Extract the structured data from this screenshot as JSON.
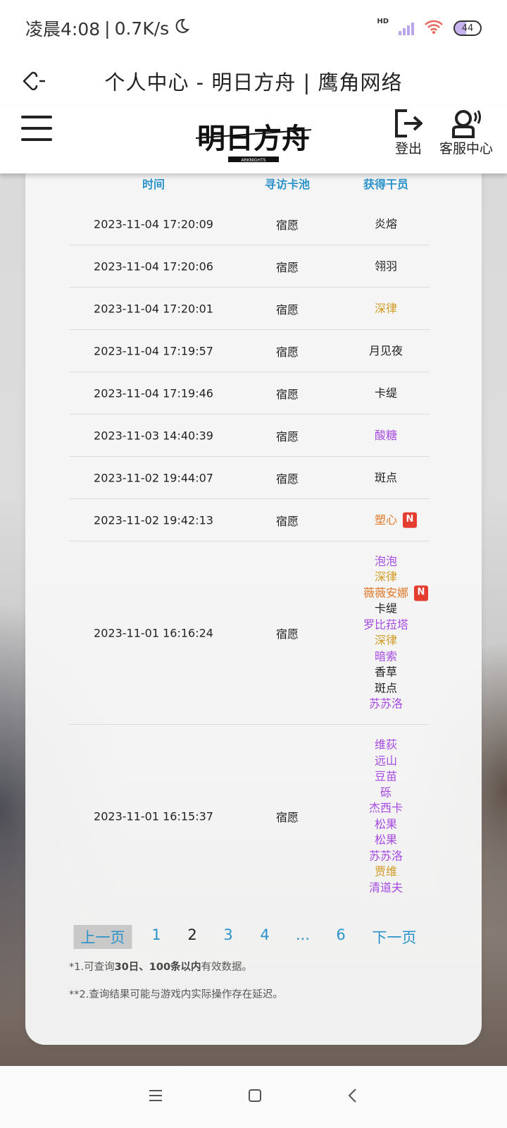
{
  "status": {
    "time": "凌晨4:08",
    "speed": "0.7K/s",
    "network": "HD",
    "battery": "44"
  },
  "browser": {
    "title": "个人中心 - 明日方舟 | 鹰角网络"
  },
  "header": {
    "logo_text": "明日方舟",
    "logo_subtext": "ARKNIGHTS",
    "logout_label": "登出",
    "service_label": "客服中心"
  },
  "table": {
    "headers": [
      "时间",
      "寻访卡池",
      "获得干员"
    ],
    "rows": [
      {
        "time": "2023-11-04 17:20:09",
        "pool": "宿愿",
        "ops": [
          {
            "name": "炎熔",
            "color": "#222222"
          }
        ]
      },
      {
        "time": "2023-11-04 17:20:06",
        "pool": "宿愿",
        "ops": [
          {
            "name": "翎羽",
            "color": "#222222"
          }
        ]
      },
      {
        "time": "2023-11-04 17:20:01",
        "pool": "宿愿",
        "ops": [
          {
            "name": "深律",
            "color": "#d19a22"
          }
        ]
      },
      {
        "time": "2023-11-04 17:19:57",
        "pool": "宿愿",
        "ops": [
          {
            "name": "月见夜",
            "color": "#222222"
          }
        ]
      },
      {
        "time": "2023-11-04 17:19:46",
        "pool": "宿愿",
        "ops": [
          {
            "name": "卡缇",
            "color": "#222222"
          }
        ]
      },
      {
        "time": "2023-11-03 14:40:39",
        "pool": "宿愿",
        "ops": [
          {
            "name": "酸糖",
            "color": "#a64be0"
          }
        ]
      },
      {
        "time": "2023-11-02 19:44:07",
        "pool": "宿愿",
        "ops": [
          {
            "name": "斑点",
            "color": "#222222"
          }
        ]
      },
      {
        "time": "2023-11-02 19:42:13",
        "pool": "宿愿",
        "ops": [
          {
            "name": "塑心",
            "color": "#e07828",
            "new": "N"
          }
        ]
      },
      {
        "time": "2023-11-01 16:16:24",
        "pool": "宿愿",
        "ops": [
          {
            "name": "泡泡",
            "color": "#a64be0"
          },
          {
            "name": "深律",
            "color": "#d19a22"
          },
          {
            "name": "薇薇安娜",
            "color": "#e07828",
            "new": "N"
          },
          {
            "name": "卡缇",
            "color": "#222222"
          },
          {
            "name": "罗比菈塔",
            "color": "#a64be0"
          },
          {
            "name": "深律",
            "color": "#d19a22"
          },
          {
            "name": "暗索",
            "color": "#a64be0"
          },
          {
            "name": "香草",
            "color": "#222222"
          },
          {
            "name": "斑点",
            "color": "#222222"
          },
          {
            "name": "苏苏洛",
            "color": "#a64be0"
          }
        ]
      },
      {
        "time": "2023-11-01 16:15:37",
        "pool": "宿愿",
        "ops": [
          {
            "name": "维荻",
            "color": "#a64be0"
          },
          {
            "name": "远山",
            "color": "#a64be0"
          },
          {
            "name": "豆苗",
            "color": "#a64be0"
          },
          {
            "name": "砾",
            "color": "#a64be0"
          },
          {
            "name": "杰西卡",
            "color": "#a64be0"
          },
          {
            "name": "松果",
            "color": "#a64be0"
          },
          {
            "name": "松果",
            "color": "#a64be0"
          },
          {
            "name": "苏苏洛",
            "color": "#a64be0"
          },
          {
            "name": "贾维",
            "color": "#d19a22"
          },
          {
            "name": "清道夫",
            "color": "#a64be0"
          }
        ]
      }
    ]
  },
  "pagination": {
    "prev": "上一页",
    "pages": [
      "1",
      "2",
      "3",
      "4",
      "...",
      "6"
    ],
    "current": "2",
    "next": "下一页"
  },
  "notes": {
    "note1_prefix": "*1.可查询",
    "note1_bold": "30日、100条以内",
    "note1_suffix": "有效数据。",
    "note2": "**2.查询结果可能与游戏内实际操作存在延迟。"
  }
}
